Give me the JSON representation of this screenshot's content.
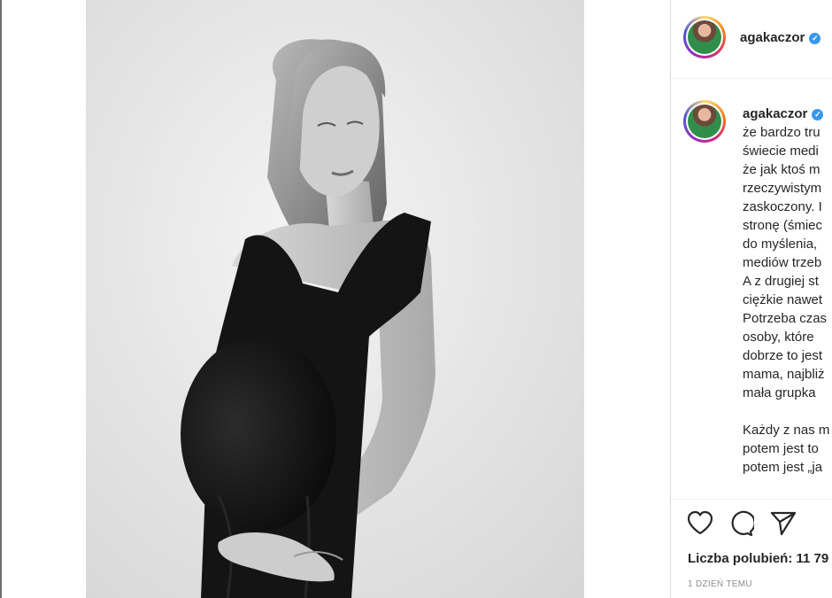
{
  "post": {
    "username": "agakaczor",
    "verified_badge": "✓",
    "caption_lines": [
      "że bardzo tru",
      "świecie medi",
      "że jak ktoś m",
      "rzeczywistym",
      "zaskoczony. I",
      "stronę (śmiec",
      "do myślenia,",
      "mediów trzeb",
      "A z drugiej st",
      "ciężkie nawet",
      "Potrzeba czas",
      "osoby, które",
      "dobrze to jest",
      "mama, najbliż",
      "mała grupka"
    ],
    "caption_lines_2": [
      "Każdy z nas m",
      "potem jest to",
      "potem jest „ja"
    ],
    "likes_text": "Liczba polubień: 11 79",
    "timestamp": "1 DZIEŃ TEMU"
  },
  "icons": {
    "like": "heart-icon",
    "comment": "comment-icon",
    "share": "share-icon",
    "verified": "verified-badge-icon"
  },
  "colors": {
    "verified": "#3897f0",
    "text": "#262626",
    "muted": "#8e8e8e"
  }
}
